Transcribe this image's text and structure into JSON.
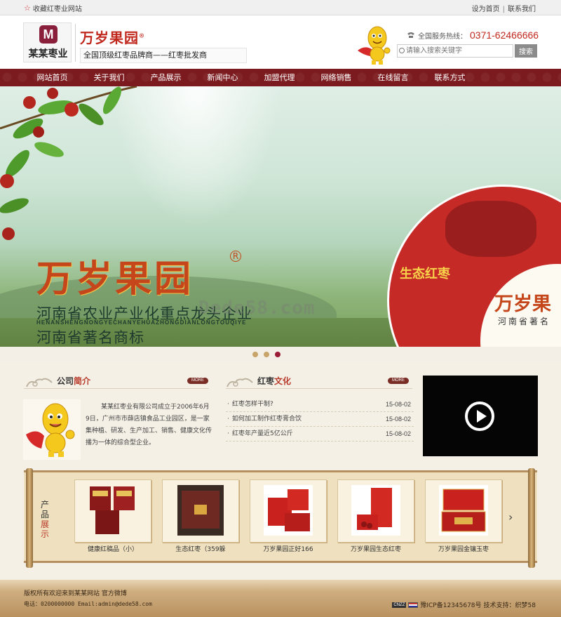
{
  "topbar": {
    "favorite": "收藏红枣业网站",
    "set_home": "设为首页",
    "contact": "联系我们"
  },
  "header": {
    "logo_letter": "M",
    "logo_name": "某某枣业",
    "brand": "万岁果园",
    "brand_mark": "®",
    "slogan": "全国顶级红枣品牌商——红枣批发商",
    "hotline_label": "全国服务热线：",
    "hotline_number": "0371-62466666",
    "search_placeholder": "请输入搜索关键字",
    "search_button": "搜索"
  },
  "nav": {
    "items": [
      "网站首页",
      "关于我们",
      "产品展示",
      "新闻中心",
      "加盟代理",
      "网络销售",
      "在线留言",
      "联系方式"
    ]
  },
  "banner": {
    "brand": "万岁果园",
    "brand_mark": "R",
    "line1": "河南省农业产业化重点龙头企业",
    "pinyin": "HENANSHENGNONGYECHANYEHUAZHONGDIANLONGTOUQIYE",
    "line2": "河南省著名商标",
    "watermark": "Dede58.com",
    "circle_brand": "万岁果",
    "circle_sub": "河南省著名",
    "circle_eco": "生态红枣",
    "dot_count": 3,
    "active_dot": 3
  },
  "about": {
    "title_main": "公司",
    "title_accent": "简介",
    "more": "MORE",
    "text": "某某红枣业有限公司成立于2006年6月9日，广州市市薛店镇食品工业园区，是一家集种植、研发、生产加工、销售、健康文化传播为一体的综合型企业。"
  },
  "news": {
    "title_main": "红枣",
    "title_accent": "文化",
    "more": "MORE",
    "items": [
      {
        "title": "红枣怎样干制?",
        "date": "15-08-02"
      },
      {
        "title": "如何加工制作红枣膏合饮",
        "date": "15-08-02"
      },
      {
        "title": "红枣年产量近5亿公斤",
        "date": "15-08-02"
      }
    ]
  },
  "products": {
    "label_main": "产品",
    "label_accent": "展示",
    "items": [
      {
        "name": "健康红稿品（小）"
      },
      {
        "name": "生态红枣（359躲"
      },
      {
        "name": "万岁果园正好166"
      },
      {
        "name": "万岁果园生态红枣"
      },
      {
        "name": "万岁果园金镶玉枣"
      }
    ]
  },
  "footer": {
    "line1": "版权所有欢迎来到某某网站 官方微博",
    "line2": "电话：0200000000 Email:admin@dede58.com",
    "badge": "CNZZ",
    "icp": "豫ICP备12345678号",
    "support": "技术支持：织梦58"
  },
  "colors": {
    "nav": "#7b1a1f",
    "accent": "#c0281e",
    "active_dot": "#9b1c37"
  }
}
